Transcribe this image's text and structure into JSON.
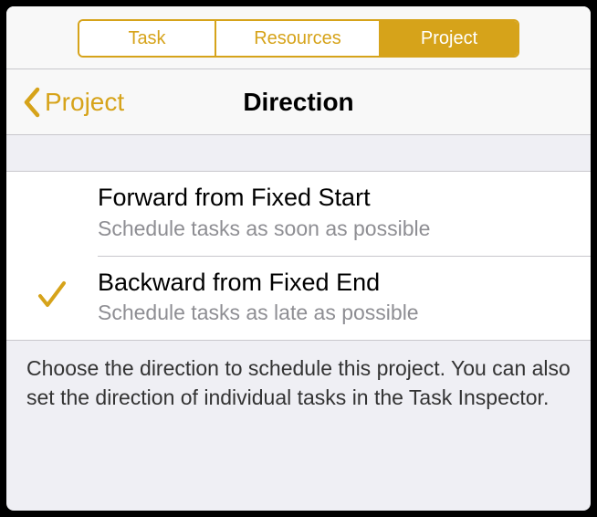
{
  "colors": {
    "accent": "#d6a31a"
  },
  "tabs": {
    "items": [
      {
        "label": "Task",
        "active": false
      },
      {
        "label": "Resources",
        "active": false
      },
      {
        "label": "Project",
        "active": true
      }
    ]
  },
  "nav": {
    "back_label": "Project",
    "title": "Direction"
  },
  "options": [
    {
      "title": "Forward from Fixed Start",
      "subtitle": "Schedule tasks as soon as possible",
      "selected": false
    },
    {
      "title": "Backward from Fixed End",
      "subtitle": "Schedule tasks as late as possible",
      "selected": true
    }
  ],
  "footer_text": "Choose the direction to schedule this project. You can also set the direction of individual tasks in the Task Inspector."
}
